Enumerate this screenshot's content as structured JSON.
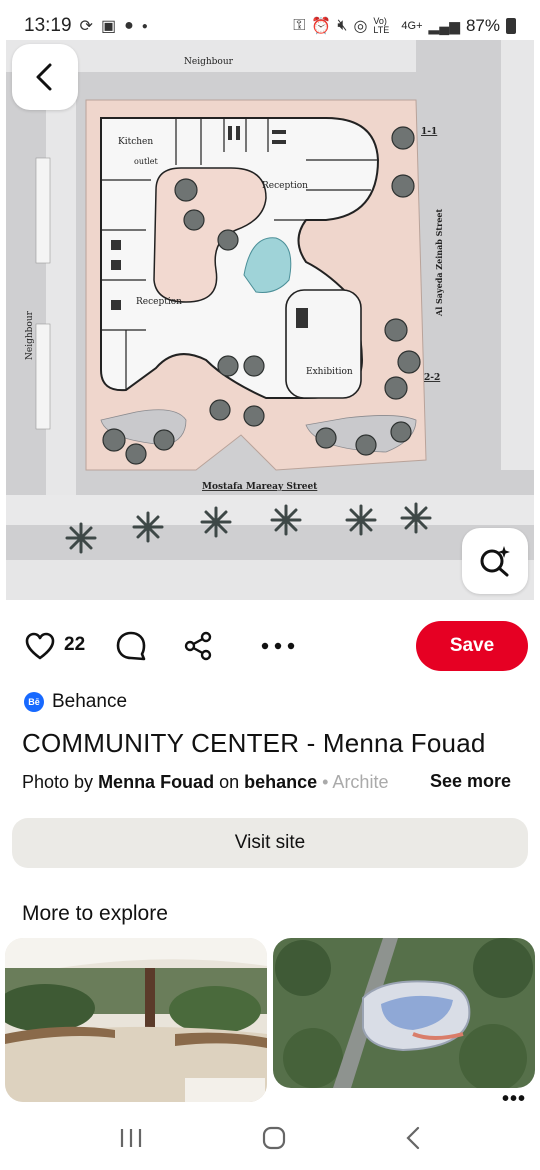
{
  "status_bar": {
    "time": "13:19",
    "network_label": "Vo) LTE",
    "network_type": "4G+",
    "battery": "87%"
  },
  "hero": {
    "labels": {
      "neighbour_top": "Neighbour",
      "neighbour_left": "Neighbour",
      "kitchen": "Kitchen",
      "outlet": "outlet",
      "reception_top": "Reception",
      "reception_left": "Reception",
      "exhibition": "Exhibition",
      "street_bottom": "Mostafa Mareay Street",
      "street_right": "Al Sayeda Zeinab Street",
      "section_1": "1-1",
      "section_2": "2-2"
    }
  },
  "actions": {
    "like_count": "22",
    "save_label": "Save"
  },
  "source": {
    "badge": "Bē",
    "name": "Behance"
  },
  "pin": {
    "title": "COMMUNITY CENTER - Menna Fouad",
    "desc_prefix": "Photo by ",
    "desc_author": "Menna Fouad",
    "desc_mid": " on ",
    "desc_site": "behance",
    "desc_suffix": " • Archite",
    "see_more": "See more"
  },
  "visit_label": "Visit site",
  "more_to_explore": "More to explore",
  "colors": {
    "save": "#e60023",
    "visit_bg": "#ebeae6",
    "behance_blue": "#1769ff"
  },
  "icons": [
    "back-arrow-icon",
    "lens-search-icon",
    "heart-icon",
    "comment-icon",
    "share-icon",
    "more-dots-icon",
    "nav-recents-icon",
    "nav-home-icon",
    "nav-back-icon"
  ]
}
